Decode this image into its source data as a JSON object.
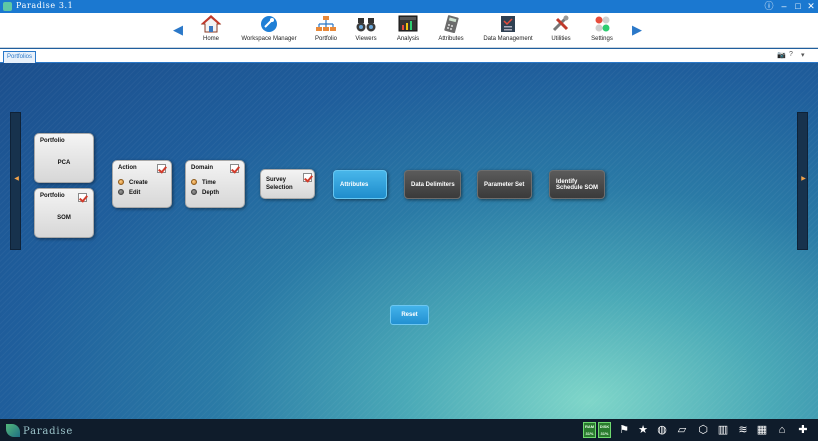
{
  "app": {
    "title": "Paradise 3.1"
  },
  "ribbon": {
    "items": [
      {
        "label": "Home",
        "icon": "home-icon"
      },
      {
        "label": "Workspace Manager",
        "icon": "workspace-manager-icon"
      },
      {
        "label": "Portfolio",
        "icon": "portfolio-icon"
      },
      {
        "label": "Viewers",
        "icon": "viewers-icon"
      },
      {
        "label": "Analysis",
        "icon": "analysis-icon"
      },
      {
        "label": "Attributes",
        "icon": "attributes-icon"
      },
      {
        "label": "Data Management",
        "icon": "data-management-icon"
      },
      {
        "label": "Utilities",
        "icon": "utilities-icon"
      },
      {
        "label": "Settings",
        "icon": "settings-icon"
      }
    ]
  },
  "tabs": [
    {
      "label": "Portfolios"
    }
  ],
  "workflow": {
    "portfolio_pca": {
      "title": "Portfolio",
      "value": "PCA"
    },
    "portfolio_som": {
      "title": "Portfolio",
      "value": "SOM",
      "checked": true
    },
    "action": {
      "title": "Action",
      "options": [
        "Create",
        "Edit"
      ],
      "selected": "Create"
    },
    "domain": {
      "title": "Domain",
      "options": [
        "Time",
        "Depth"
      ],
      "selected": "Time"
    },
    "survey": {
      "title_line1": "Survey",
      "title_line2": "Selection"
    },
    "steps": [
      {
        "label": "Attributes",
        "state": "active"
      },
      {
        "label": "Data Delimiters",
        "state": "inactive"
      },
      {
        "label": "Parameter Set",
        "state": "inactive"
      },
      {
        "label_line1": "Identify",
        "label_line2": "Schedule SOM",
        "state": "inactive"
      }
    ],
    "reset_label": "Reset"
  },
  "statusbar": {
    "brand": "Paradise",
    "meters": [
      {
        "label": "RAM",
        "value": "31%"
      },
      {
        "label": "DISK",
        "value": "31%"
      }
    ]
  },
  "colors": {
    "accent": "#1b78d0",
    "active_step": "#2a9ad8",
    "inactive_step": "#474747",
    "check": "#d23b2b"
  }
}
